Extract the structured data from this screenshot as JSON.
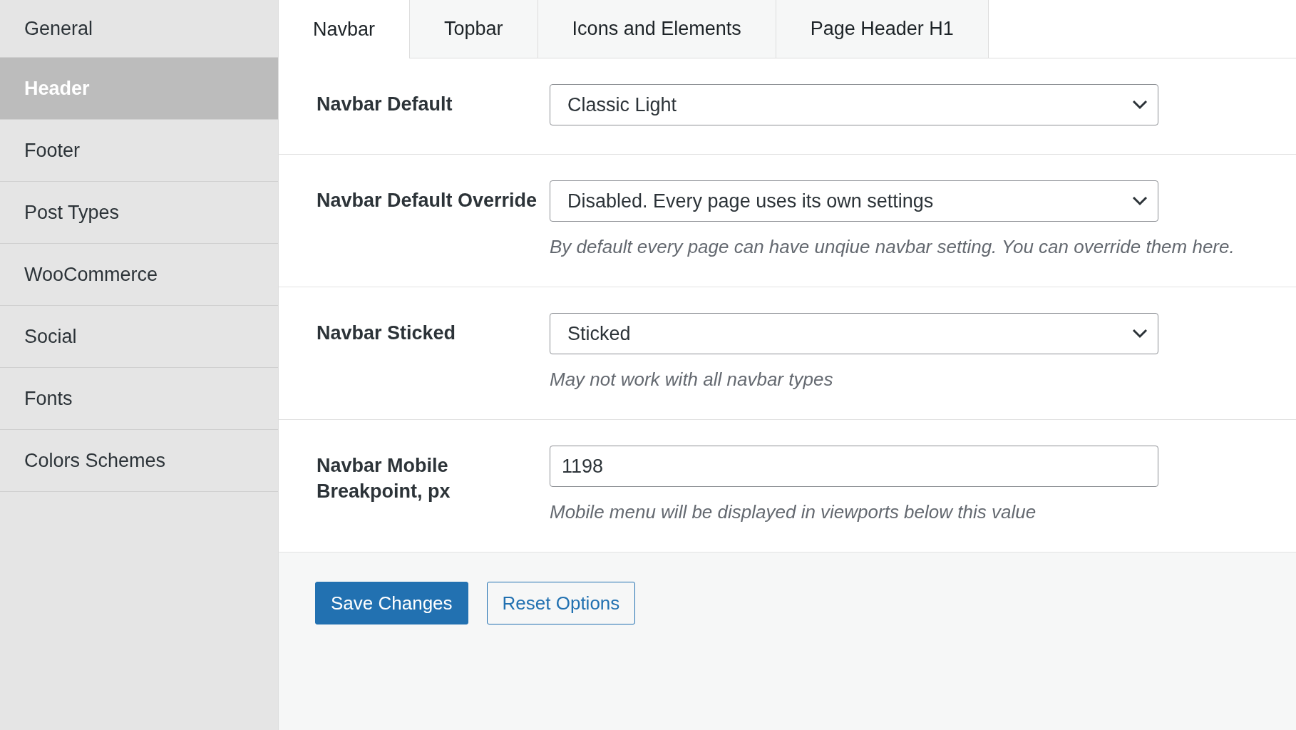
{
  "sidebar": {
    "items": [
      {
        "label": "General",
        "selected": false
      },
      {
        "label": "Header",
        "selected": true
      },
      {
        "label": "Footer",
        "selected": false
      },
      {
        "label": "Post Types",
        "selected": false
      },
      {
        "label": "WooCommerce",
        "selected": false
      },
      {
        "label": "Social",
        "selected": false
      },
      {
        "label": "Fonts",
        "selected": false
      },
      {
        "label": "Colors Schemes",
        "selected": false
      }
    ]
  },
  "tabs": [
    {
      "label": "Navbar",
      "selected": true
    },
    {
      "label": "Topbar",
      "selected": false
    },
    {
      "label": "Icons and Elements",
      "selected": false
    },
    {
      "label": "Page Header H1",
      "selected": false
    }
  ],
  "fields": [
    {
      "label": "Navbar Default",
      "kind": "select",
      "value": "Classic Light"
    },
    {
      "label": "Navbar Default Override",
      "kind": "select",
      "value": "Disabled. Every page uses its own settings",
      "description": "By default every page can have unqiue navbar setting. You can override them here."
    },
    {
      "label": "Navbar Sticked",
      "kind": "select",
      "value": "Sticked",
      "description": "May not work with all navbar types"
    },
    {
      "label": "Navbar Mobile Breakpoint, px",
      "kind": "input",
      "value": "1198",
      "description": "Mobile menu will be displayed in viewports below this value"
    }
  ],
  "buttons": [
    {
      "label": "Save Changes",
      "kind": "primary"
    },
    {
      "label": "Reset Options",
      "kind": "secondary"
    }
  ]
}
